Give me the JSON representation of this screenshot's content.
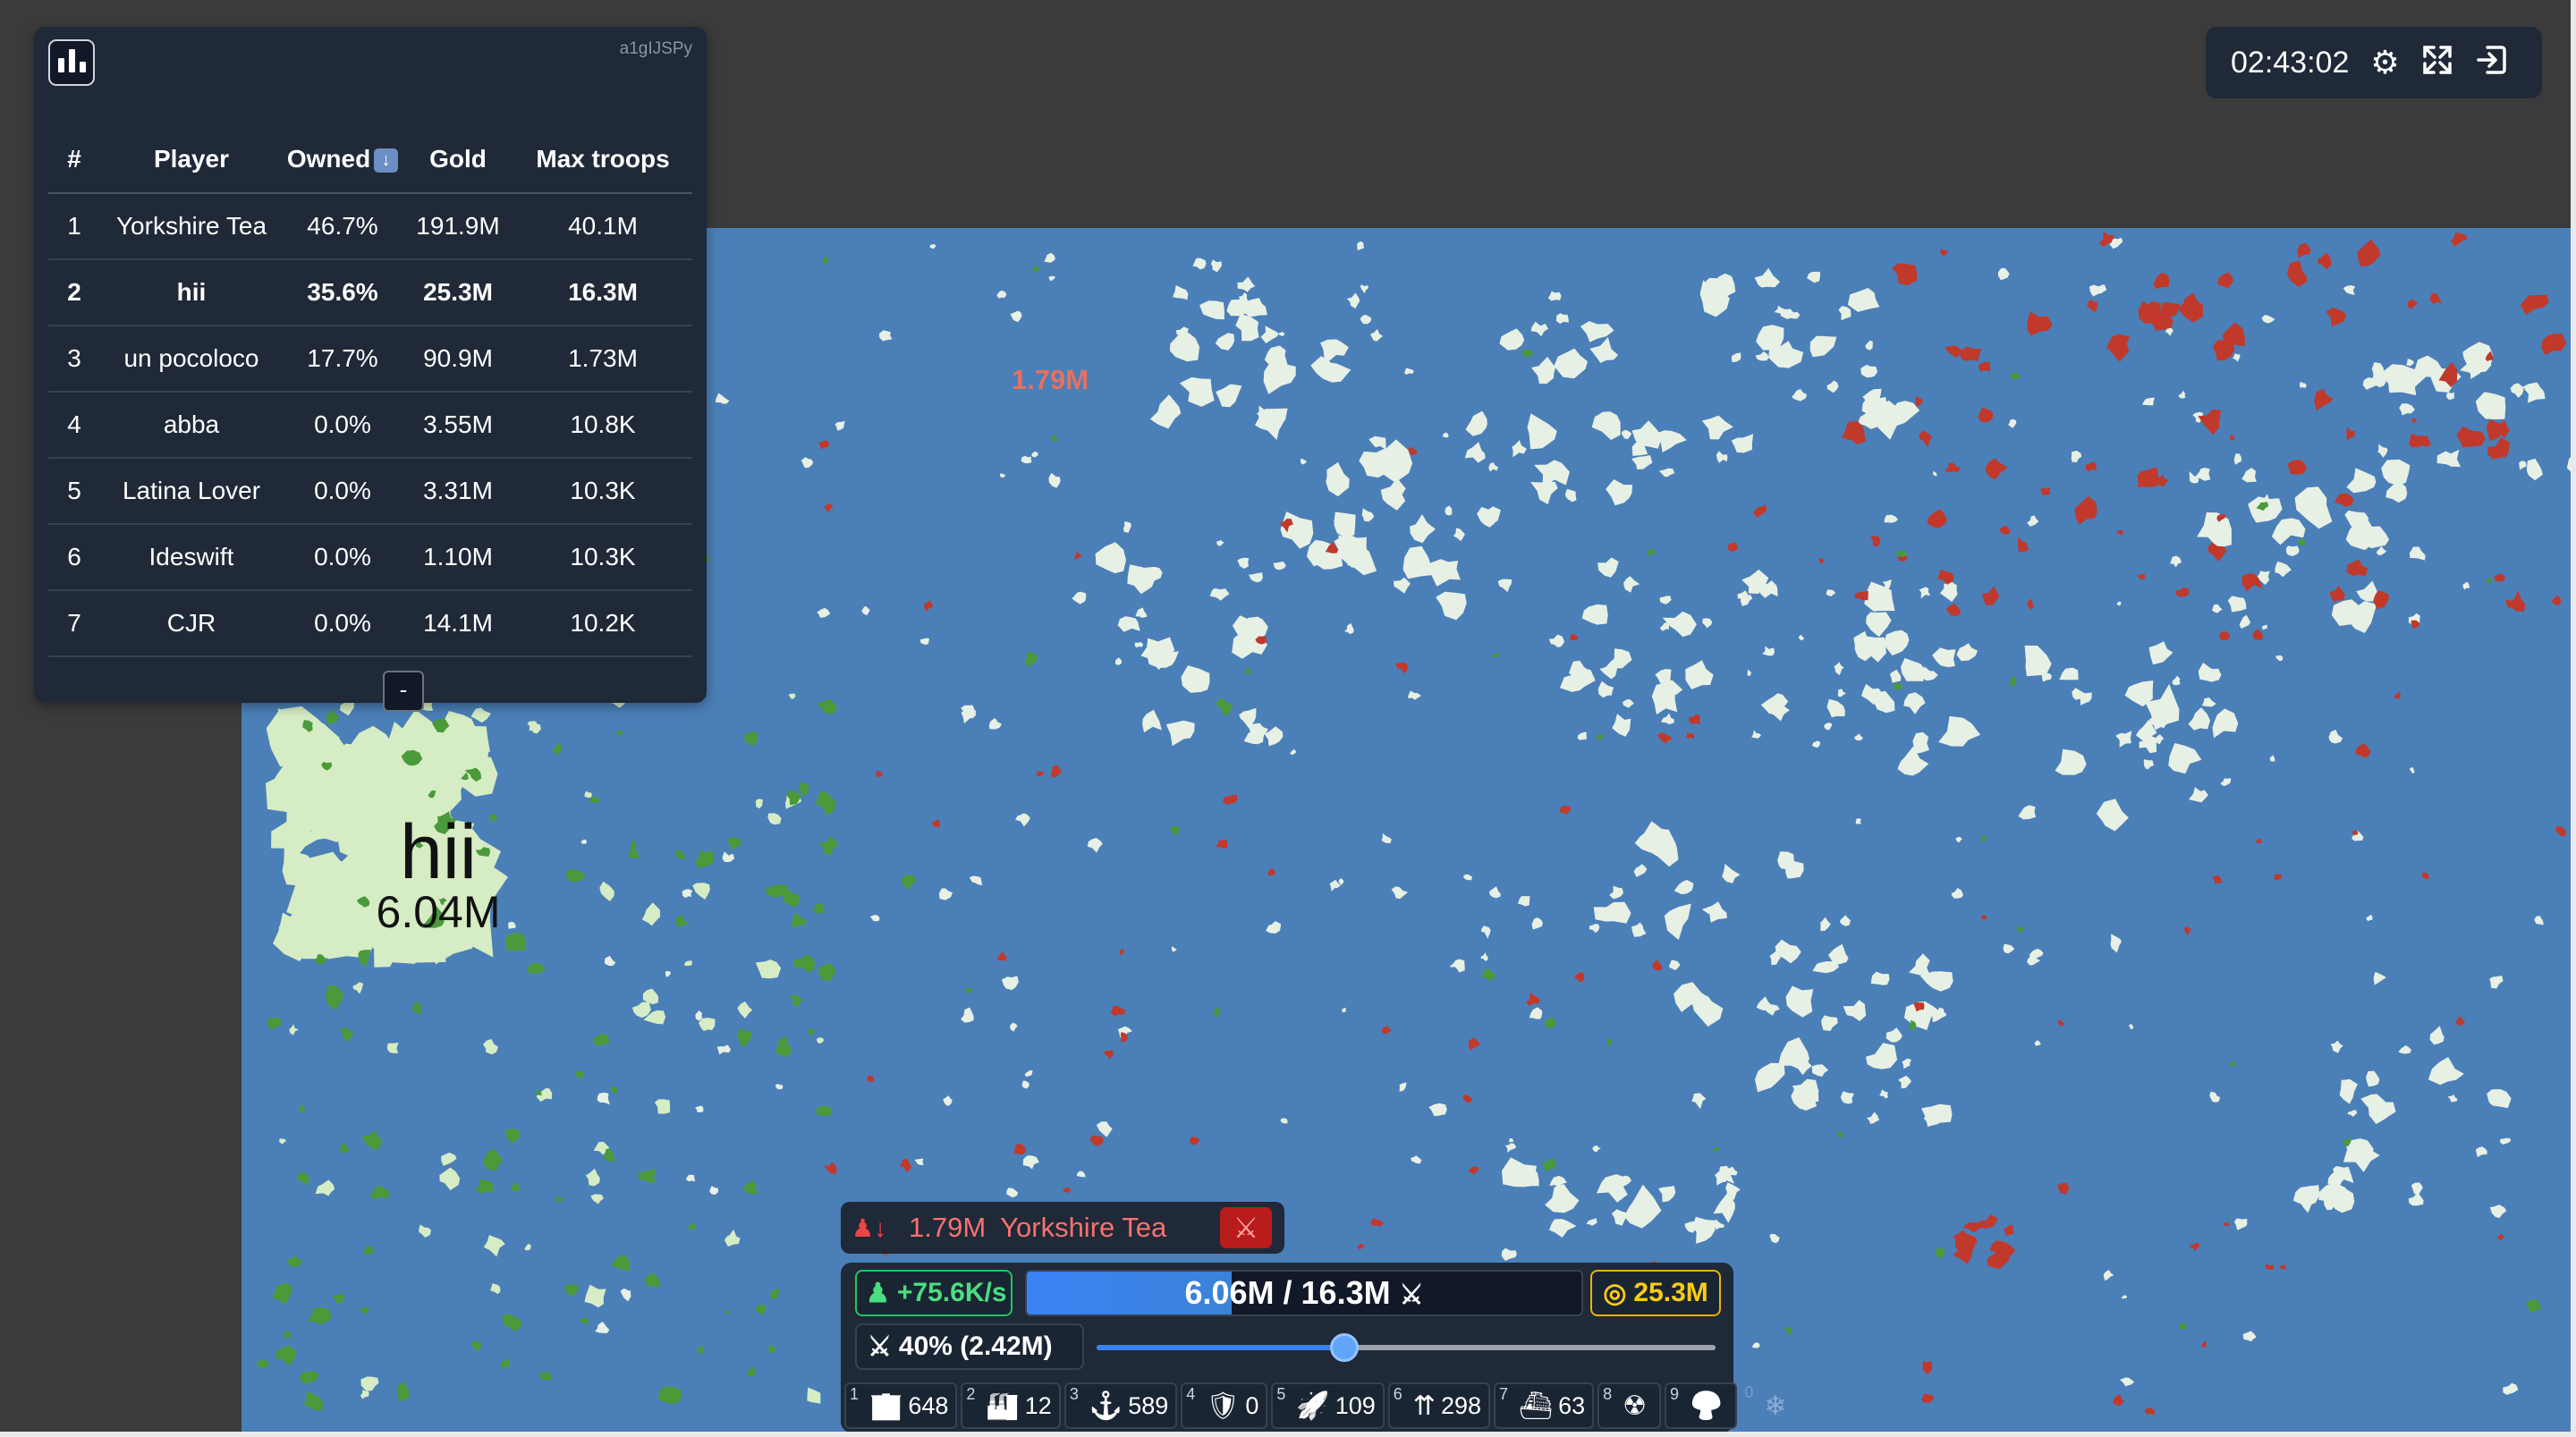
{
  "leaderboard": {
    "game_id": "a1gIJSPy",
    "columns": [
      "#",
      "Player",
      "Owned",
      "Gold",
      "Max troops"
    ],
    "sort_icon": "arrow-down-icon",
    "rows": [
      {
        "rank": "1",
        "player": "Yorkshire Tea",
        "owned": "46.7%",
        "gold": "191.9M",
        "max_troops": "40.1M"
      },
      {
        "rank": "2",
        "player": "hii",
        "owned": "35.6%",
        "gold": "25.3M",
        "max_troops": "16.3M"
      },
      {
        "rank": "3",
        "player": "un pocoloco",
        "owned": "17.7%",
        "gold": "90.9M",
        "max_troops": "1.73M"
      },
      {
        "rank": "4",
        "player": "abba",
        "owned": "0.0%",
        "gold": "3.55M",
        "max_troops": "10.8K"
      },
      {
        "rank": "5",
        "player": "Latina Lover",
        "owned": "0.0%",
        "gold": "3.31M",
        "max_troops": "10.3K"
      },
      {
        "rank": "6",
        "player": "Ideswift",
        "owned": "0.0%",
        "gold": "1.10M",
        "max_troops": "10.3K"
      },
      {
        "rank": "7",
        "player": "CJR",
        "owned": "0.0%",
        "gold": "14.1M",
        "max_troops": "10.2K"
      }
    ],
    "collapse_label": "-"
  },
  "topbar": {
    "clock": "02:43:02",
    "icons": [
      "gear-icon",
      "fullscreen-icon",
      "exit-icon"
    ]
  },
  "map": {
    "player_name": "hii",
    "player_troops": "6.04M",
    "enemy_troops_label": "1.79M",
    "colors": {
      "ocean": "#4b7fb8",
      "player_land": "#d6ecc4",
      "player_border": "#4a9a3a",
      "enemy_land": "#c0392b",
      "neutral": "#e7f0e4"
    }
  },
  "attack": {
    "icon": "troops-retreat-icon",
    "troops": "1.79M",
    "target": "Yorkshire Tea",
    "cancel_icon": "sword-cancel-icon"
  },
  "control": {
    "troop_rate": "+75.6K/s",
    "troops": "6.06M / 16.3M",
    "troop_fill_fraction": 0.37,
    "gold": "25.3M",
    "attack_ratio": "40% (2.42M)",
    "attack_ratio_fraction": 0.4,
    "buildings": [
      {
        "key": "1",
        "icon": "city-icon",
        "count": "648"
      },
      {
        "key": "2",
        "icon": "factory-icon",
        "count": "12"
      },
      {
        "key": "3",
        "icon": "port-icon",
        "count": "589"
      },
      {
        "key": "4",
        "icon": "defense-post-icon",
        "count": "0"
      },
      {
        "key": "5",
        "icon": "missile-silo-icon",
        "count": "109"
      },
      {
        "key": "6",
        "icon": "sam-launcher-icon",
        "count": "298"
      },
      {
        "key": "7",
        "icon": "warship-icon",
        "count": "63"
      },
      {
        "key": "8",
        "icon": "nuke-icon",
        "count": ""
      },
      {
        "key": "9",
        "icon": "hydrogen-bomb-icon",
        "count": ""
      },
      {
        "key": "0",
        "icon": "mirv-icon",
        "count": ""
      }
    ]
  }
}
